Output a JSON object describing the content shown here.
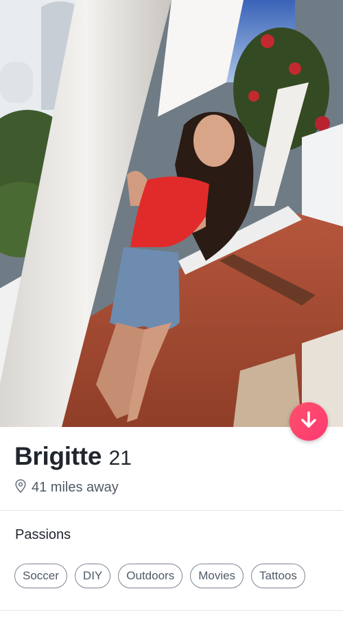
{
  "profile": {
    "name": "Brigitte",
    "age": "21",
    "distance": "41 miles away"
  },
  "passions": {
    "title": "Passions",
    "items": [
      "Soccer",
      "DIY",
      "Outdoors",
      "Movies",
      "Tattoos"
    ]
  },
  "icons": {
    "location": "location-pin-icon",
    "collapse": "arrow-down-icon"
  },
  "colors": {
    "accent": "#fd3a73",
    "name_text": "#21262e",
    "secondary_text": "#505965",
    "chip_border": "#7c8591"
  }
}
